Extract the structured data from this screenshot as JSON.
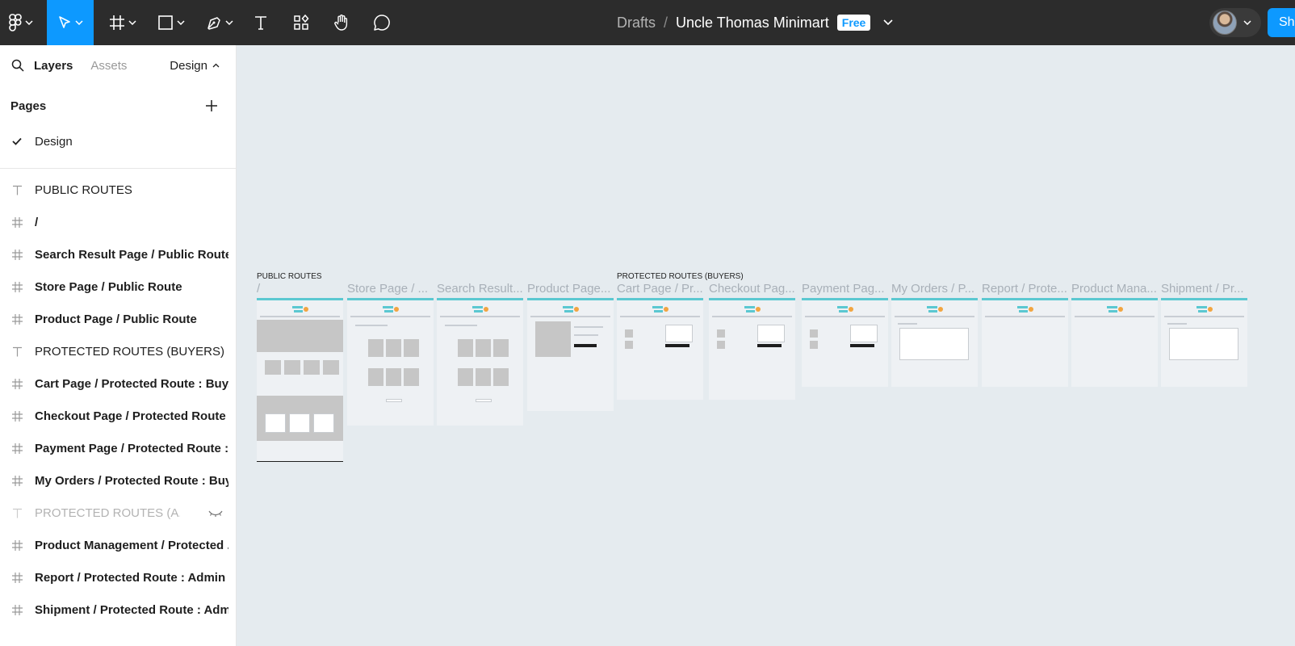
{
  "toolbar": {
    "tools": [
      "figma-menu-icon",
      "move-tool-icon",
      "frame-tool-icon",
      "shape-tool-icon",
      "pen-tool-icon",
      "text-tool-icon",
      "resources-icon",
      "hand-tool-icon",
      "comment-tool-icon"
    ],
    "accent": "#0d99ff",
    "breadcrumb": "Drafts",
    "separator": "/",
    "file_name": "Uncle Thomas Minimart",
    "plan_badge": "Free",
    "share_label": "Sha"
  },
  "sidebar": {
    "tab_layers": "Layers",
    "tab_assets": "Assets",
    "design_dropdown": "Design",
    "pages_heading": "Pages",
    "pages": [
      {
        "label": "Design",
        "selected": true
      }
    ],
    "layers": [
      {
        "label": "PUBLIC ROUTES",
        "type": "text"
      },
      {
        "label": "/",
        "type": "frame"
      },
      {
        "label": "Search Result Page / Public Route",
        "type": "frame"
      },
      {
        "label": "Store Page / Public Route",
        "type": "frame"
      },
      {
        "label": "Product Page / Public Route",
        "type": "frame"
      },
      {
        "label": "PROTECTED ROUTES (BUYERS)",
        "type": "text"
      },
      {
        "label": "Cart Page / Protected Route : Buy...",
        "type": "frame"
      },
      {
        "label": "Checkout Page / Protected Route ...",
        "type": "frame"
      },
      {
        "label": "Payment Page / Protected Route : ...",
        "type": "frame"
      },
      {
        "label": "My Orders / Protected Route : Buy...",
        "type": "frame"
      },
      {
        "label": "PROTECTED ROUTES (A...",
        "type": "text-hidden"
      },
      {
        "label": "Product Management / Protected ...",
        "type": "frame"
      },
      {
        "label": "Report / Protected Route : Admin",
        "type": "frame"
      },
      {
        "label": "Shipment / Protected Route : Admin",
        "type": "frame"
      }
    ]
  },
  "canvas": {
    "section_public": "PUBLIC ROUTES",
    "section_protected": "PROTECTED ROUTES (BUYERS)",
    "frames": [
      "/",
      "Store Page / ...",
      "Search Result...",
      "Product Page...",
      "Cart Page / Pr...",
      "Checkout Pag...",
      "Payment Pag...",
      "My Orders / P...",
      "Report / Prote...",
      "Product Mana...",
      "Shipment / Pr..."
    ]
  }
}
